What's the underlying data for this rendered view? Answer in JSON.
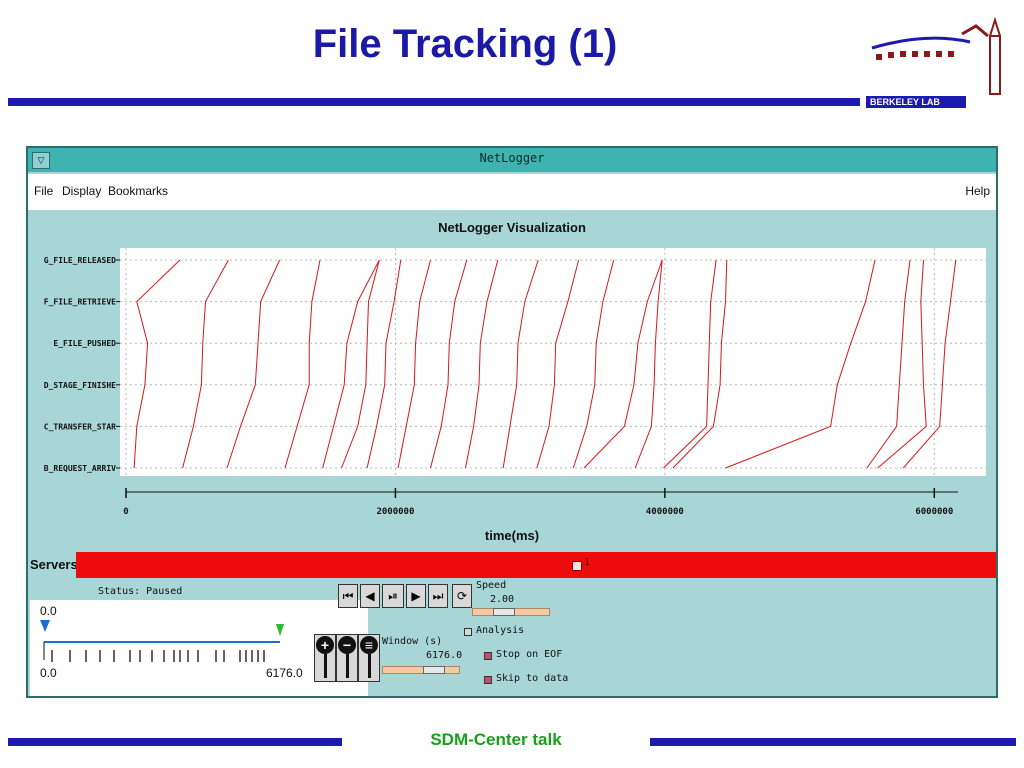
{
  "slide": {
    "title": "File Tracking (1)",
    "logo_text": "BERKELEY LAB",
    "footer": "SDM-Center talk"
  },
  "window": {
    "title": "NetLogger",
    "menu_left": [
      "File",
      "Display",
      "Bookmarks"
    ],
    "menu_right": "Help"
  },
  "chart_data": {
    "type": "line",
    "title": "NetLogger Visualization",
    "xlabel": "time(ms)",
    "ylabel": "",
    "xlim": [
      0,
      6176000
    ],
    "x_ticks": [
      {
        "value": 0,
        "label": "0"
      },
      {
        "value": 2000000,
        "label": "2000000"
      },
      {
        "value": 4000000,
        "label": "4000000"
      },
      {
        "value": 6000000,
        "label": "6000000"
      }
    ],
    "y_categories": [
      "B_REQUEST_ARRIV",
      "C_TRANSFER_STAR",
      "D_STAGE_FINISHE",
      "E_FILE_PUSHED",
      "F_FILE_RETRIEVE",
      "G_FILE_RELEASED"
    ],
    "grid": true,
    "color": "#d81818",
    "lifelines": [
      [
        60000,
        80000,
        140000,
        160000,
        80000,
        400000
      ],
      [
        420000,
        500000,
        560000,
        570000,
        590000,
        760000
      ],
      [
        750000,
        850000,
        960000,
        980000,
        1000000,
        1140000
      ],
      [
        1180000,
        1270000,
        1360000,
        1360000,
        1380000,
        1440000
      ],
      [
        1460000,
        1540000,
        1620000,
        1640000,
        1720000,
        1880000
      ],
      [
        1600000,
        1720000,
        1780000,
        1790000,
        1800000,
        1880000
      ],
      [
        1790000,
        1860000,
        1920000,
        1930000,
        1990000,
        2040000
      ],
      [
        2020000,
        2080000,
        2140000,
        2150000,
        2180000,
        2260000
      ],
      [
        2260000,
        2340000,
        2390000,
        2400000,
        2440000,
        2530000
      ],
      [
        2520000,
        2580000,
        2620000,
        2630000,
        2680000,
        2760000
      ],
      [
        2800000,
        2850000,
        2900000,
        2910000,
        2960000,
        3060000
      ],
      [
        3050000,
        3140000,
        3180000,
        3190000,
        3280000,
        3360000
      ],
      [
        3320000,
        3420000,
        3480000,
        3490000,
        3540000,
        3620000
      ],
      [
        3400000,
        3700000,
        3770000,
        3800000,
        3870000,
        3980000
      ],
      [
        3780000,
        3900000,
        3920000,
        3930000,
        3950000,
        3980000
      ],
      [
        3990000,
        4310000,
        4320000,
        4330000,
        4340000,
        4380000
      ],
      [
        4060000,
        4360000,
        4410000,
        4420000,
        4450000,
        4460000
      ],
      [
        4450000,
        5230000,
        5280000,
        5380000,
        5490000,
        5560000
      ],
      [
        5500000,
        5720000,
        5740000,
        5760000,
        5780000,
        5820000
      ],
      [
        5580000,
        5940000,
        5920000,
        5910000,
        5900000,
        5920000
      ],
      [
        5770000,
        6040000,
        6060000,
        6080000,
        6120000,
        6160000
      ]
    ]
  },
  "servers": {
    "label": "Servers:",
    "entry": "1"
  },
  "status": {
    "text": "Status: Paused",
    "top_value": "0.0",
    "range_start": "0.0",
    "range_end": "6176.0"
  },
  "controls": {
    "speed_label": "Speed",
    "speed_value": "2.00",
    "speed_level": 0.35,
    "window_label": "Window (s)",
    "window_value": "6176.0",
    "window_level": 0.72,
    "analysis_label": "Analysis",
    "analysis_checked": false,
    "stop_on_eof_label": "Stop on EOF",
    "stop_on_eof_checked": true,
    "skip_to_data_label": "Skip to data",
    "skip_to_data_checked": true,
    "buttons": [
      "to-start",
      "step-back",
      "play-pause",
      "step-forward",
      "to-end",
      "loop"
    ],
    "zoom_buttons": [
      "zoom-in",
      "zoom-out",
      "zoom-fit"
    ]
  }
}
